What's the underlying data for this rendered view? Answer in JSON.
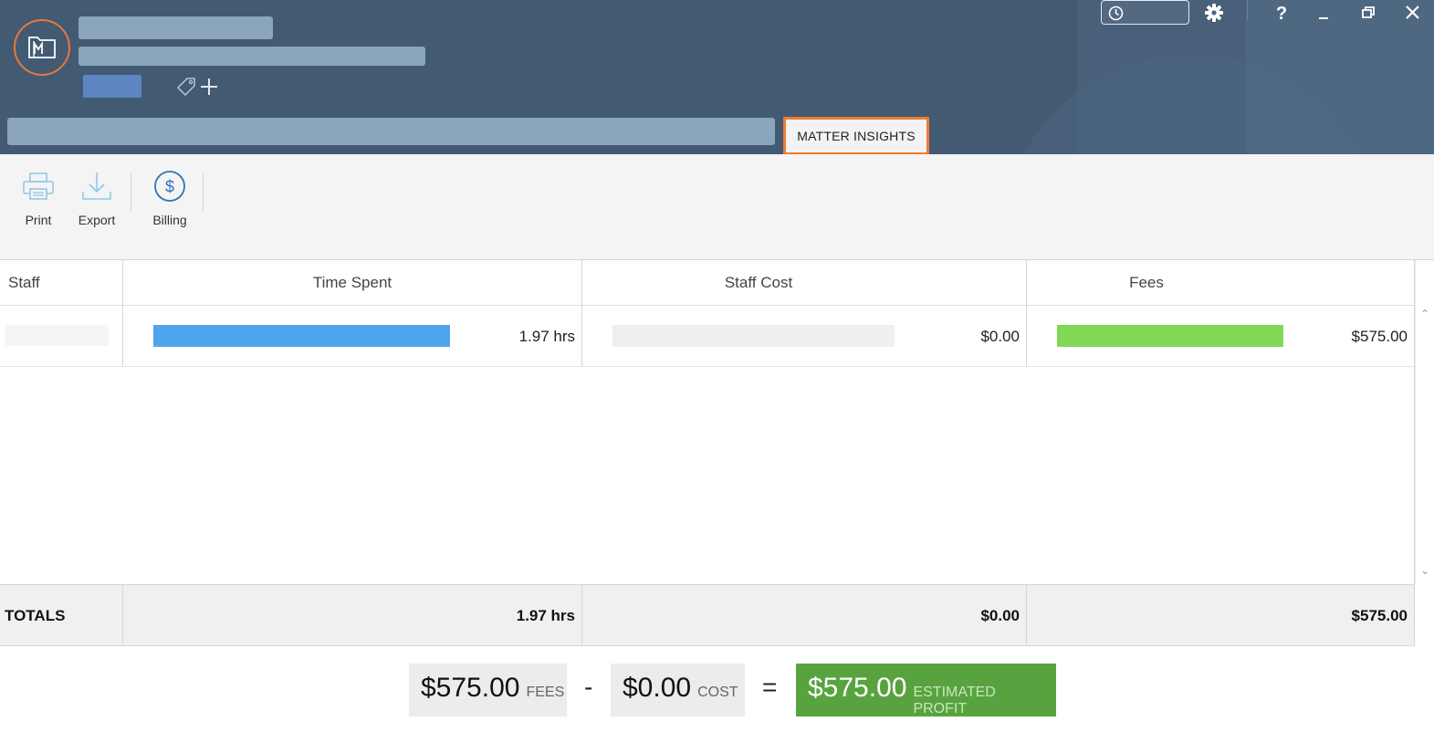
{
  "header": {
    "active_tab": "MATTER INSIGHTS"
  },
  "toolbar": {
    "print_label": "Print",
    "export_label": "Export",
    "billing_label": "Billing"
  },
  "grid": {
    "columns": [
      "Staff",
      "Time Spent",
      "Staff Cost",
      "Fees"
    ],
    "rows": [
      {
        "staff": "",
        "time_spent": "1.97 hrs",
        "staff_cost": "$0.00",
        "fees": "$575.00"
      }
    ],
    "totals": {
      "label": "TOTALS",
      "time_spent": "1.97 hrs",
      "staff_cost": "$0.00",
      "fees": "$575.00"
    }
  },
  "summary": {
    "fees_amount": "$575.00",
    "fees_caption": "FEES",
    "minus": "-",
    "cost_amount": "$0.00",
    "cost_caption": "COST",
    "equals": "=",
    "profit_amount": "$575.00",
    "profit_caption": "ESTIMATED PROFIT"
  },
  "colors": {
    "header_bg": "#435a73",
    "accent_orange": "#ef7b33",
    "time_bar": "#4fa6ef",
    "fees_bar": "#80d854",
    "profit_bg": "#58a33f"
  }
}
